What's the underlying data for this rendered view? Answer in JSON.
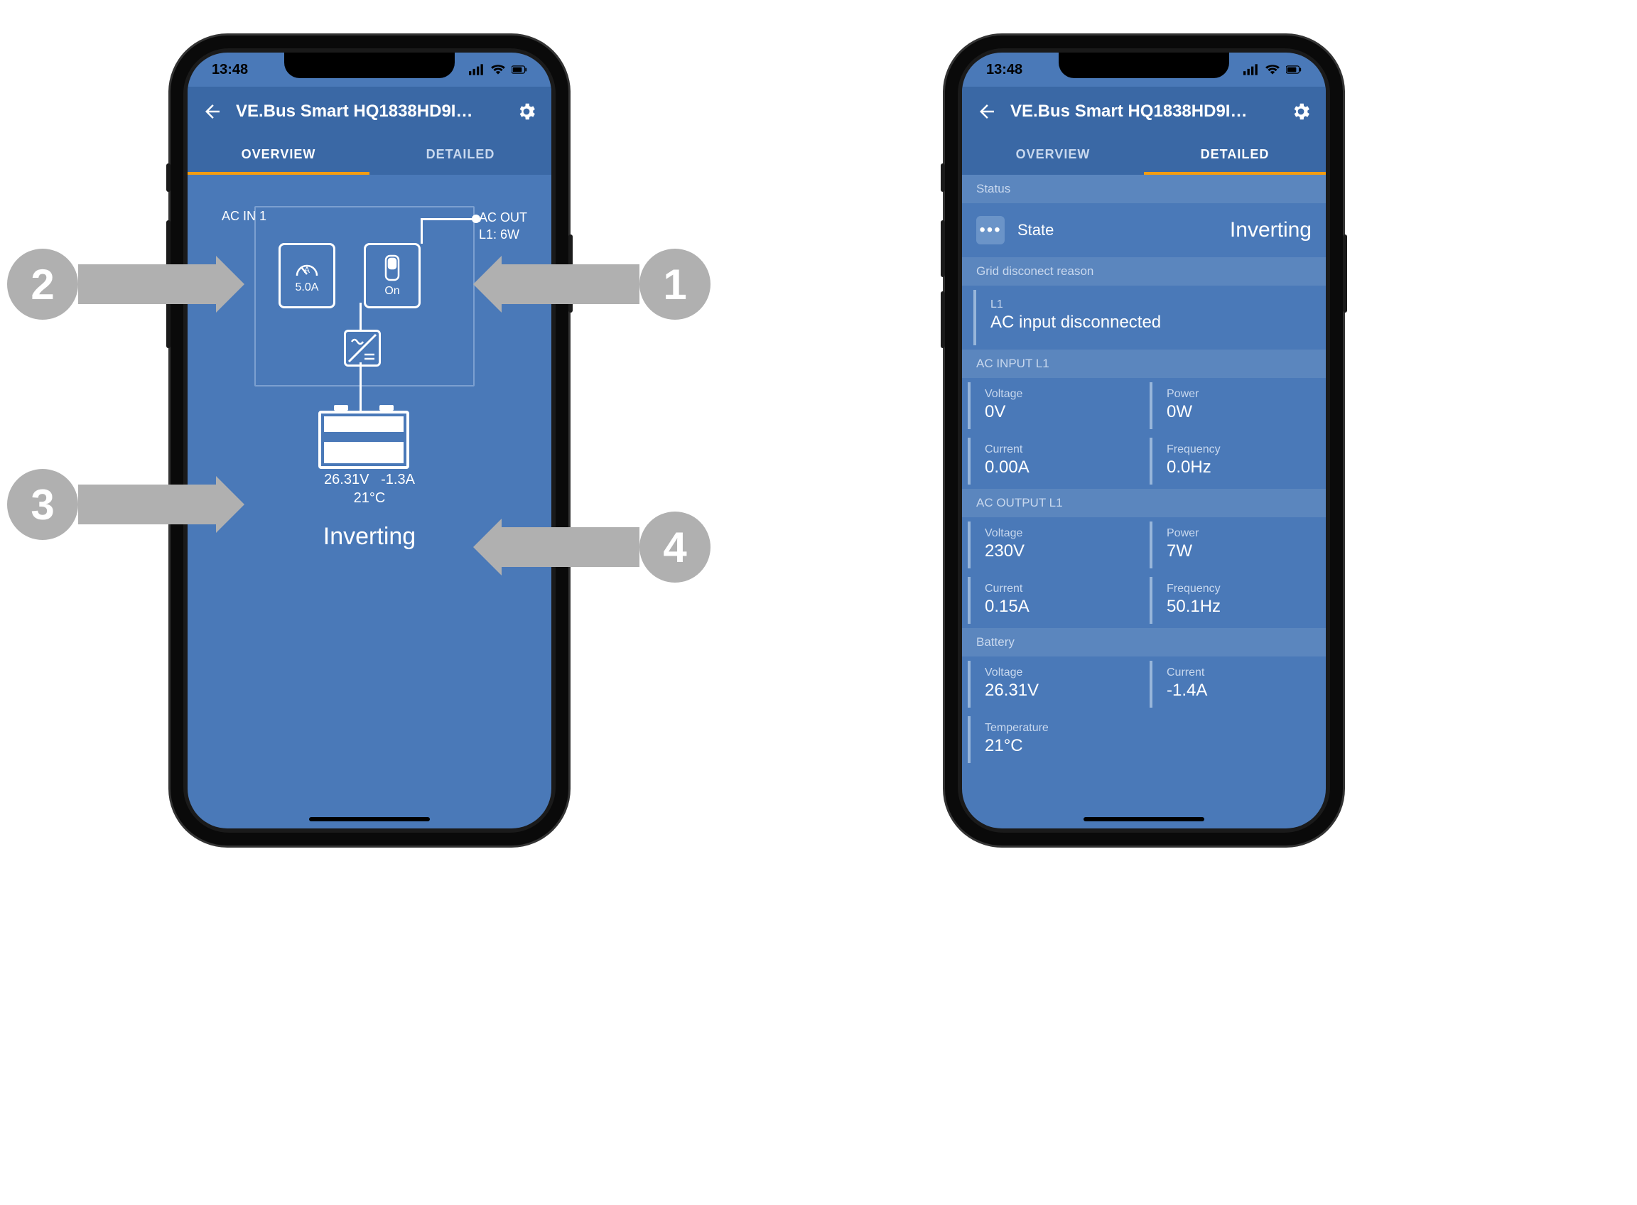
{
  "statusbar": {
    "time": "13:48"
  },
  "header": {
    "title": "VE.Bus Smart HQ1838HD9I…"
  },
  "tabs": {
    "overview": "OVERVIEW",
    "detailed": "DETAILED"
  },
  "overview": {
    "ac_in_label": "AC IN 1",
    "ac_out_label": "AC OUT",
    "ac_out_line": "L1: 6W",
    "amp_value": "5.0A",
    "switch_label": "On",
    "battery_voltage": "26.31V",
    "battery_current": "-1.3A",
    "battery_temp": "21°C",
    "status": "Inverting"
  },
  "detailed": {
    "status_section": "Status",
    "state_label": "State",
    "state_value": "Inverting",
    "grid_section": "Grid disconect reason",
    "grid_line": "L1",
    "grid_reason": "AC input disconnected",
    "ac_input_section": "AC INPUT L1",
    "ac_in": {
      "voltage_lbl": "Voltage",
      "voltage": "0V",
      "power_lbl": "Power",
      "power": "0W",
      "current_lbl": "Current",
      "current": "0.00A",
      "freq_lbl": "Frequency",
      "freq": "0.0Hz"
    },
    "ac_output_section": "AC OUTPUT L1",
    "ac_out": {
      "voltage_lbl": "Voltage",
      "voltage": "230V",
      "power_lbl": "Power",
      "power": "7W",
      "current_lbl": "Current",
      "current": "0.15A",
      "freq_lbl": "Frequency",
      "freq": "50.1Hz"
    },
    "battery_section": "Battery",
    "battery": {
      "voltage_lbl": "Voltage",
      "voltage": "26.31V",
      "current_lbl": "Current",
      "current": "-1.4A",
      "temp_lbl": "Temperature",
      "temp": "21°C"
    }
  },
  "callouts": {
    "c1": "1",
    "c2": "2",
    "c3": "3",
    "c4": "4"
  }
}
